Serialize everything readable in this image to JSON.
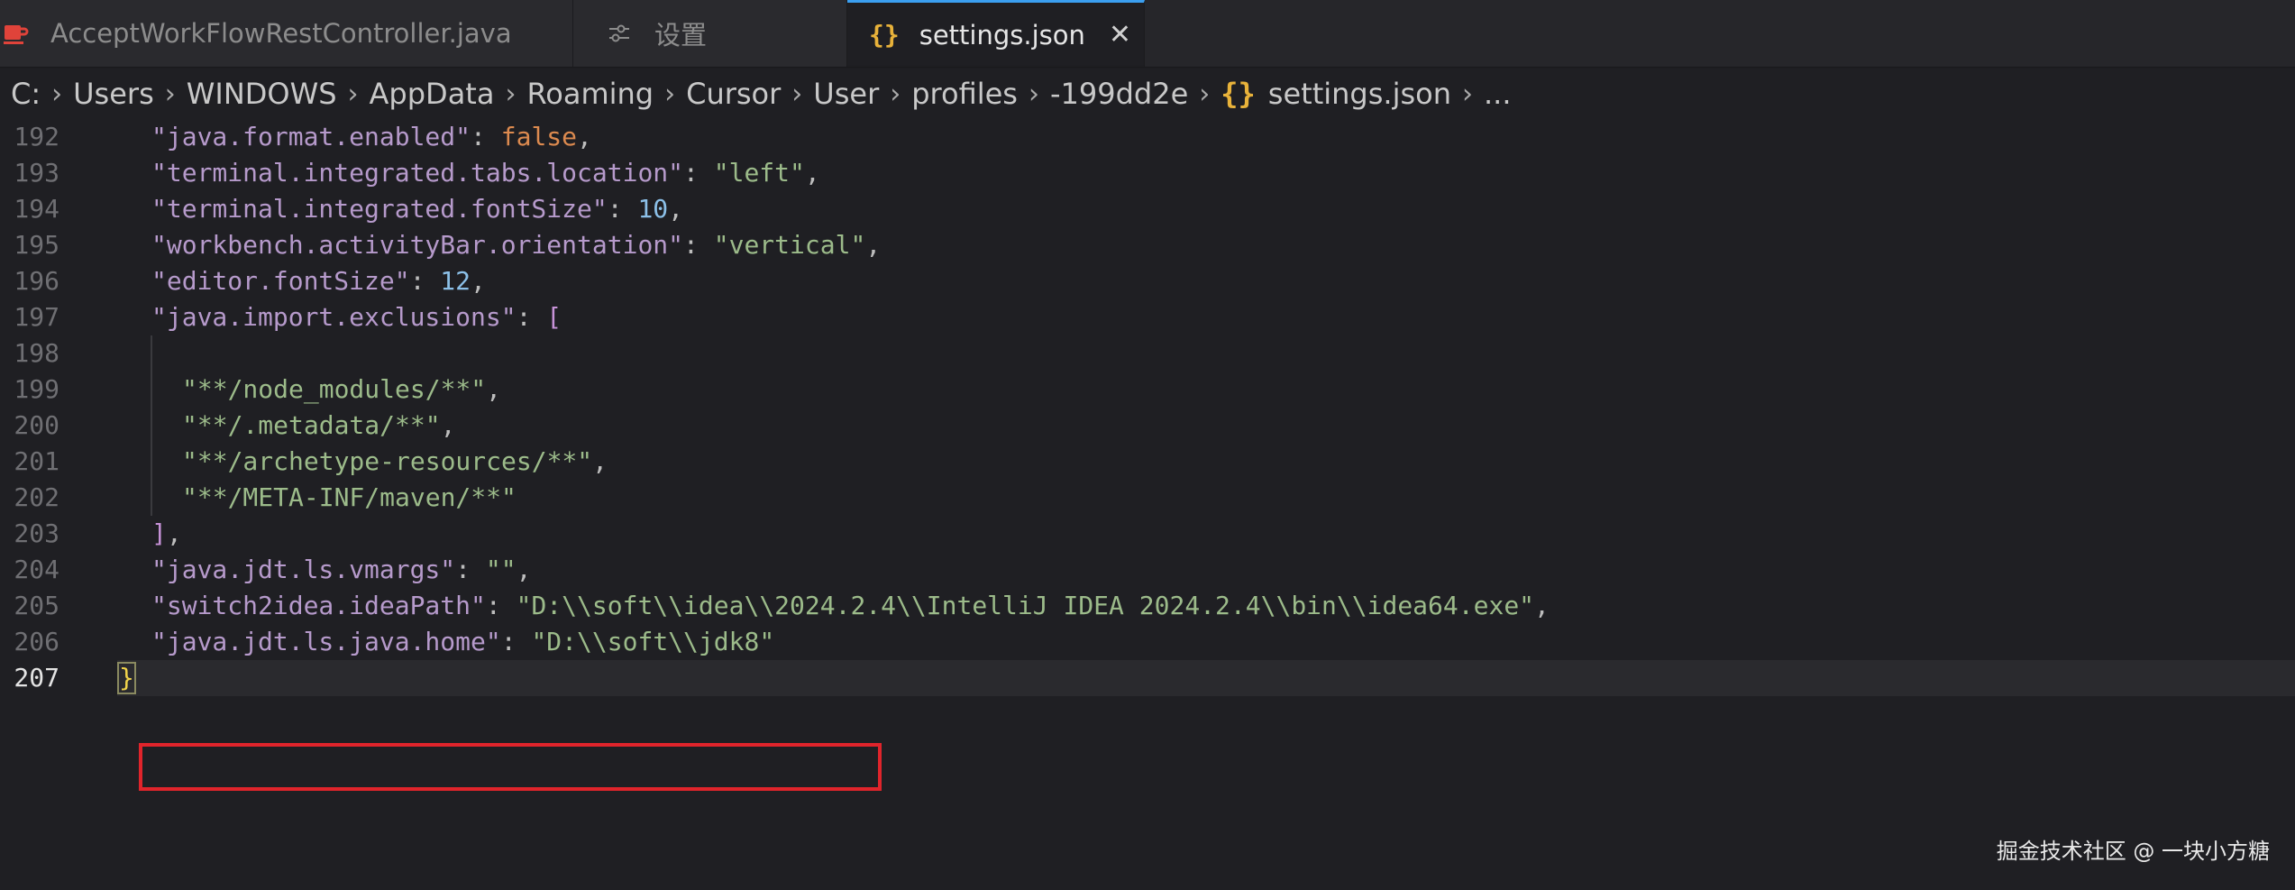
{
  "tabs": [
    {
      "label": "AcceptWorkFlowRestController.java",
      "icon": "java-icon",
      "active": false
    },
    {
      "label": "设置",
      "icon": "settings-icon",
      "active": false
    },
    {
      "label": "settings.json",
      "icon": "json-braces-icon",
      "active": true
    }
  ],
  "breadcrumb": [
    "C:",
    "Users",
    "WINDOWS",
    "AppData",
    "Roaming",
    "Cursor",
    "User",
    "profiles",
    "-199dd2e",
    "settings.json",
    "..."
  ],
  "editor": {
    "line_numbers": [
      "192",
      "193",
      "194",
      "195",
      "196",
      "197",
      "198",
      "199",
      "200",
      "201",
      "202",
      "203",
      "204",
      "205",
      "206",
      "207"
    ],
    "current_line": "207",
    "lines": {
      "l192": {
        "key": "\"java.format.enabled\"",
        "sep": ": ",
        "value": "false",
        "end": ","
      },
      "l193": {
        "key": "\"terminal.integrated.tabs.location\"",
        "sep": ": ",
        "value": "\"left\"",
        "end": ","
      },
      "l194": {
        "key": "\"terminal.integrated.fontSize\"",
        "sep": ": ",
        "value": "10",
        "end": ","
      },
      "l195": {
        "key": "\"workbench.activityBar.orientation\"",
        "sep": ": ",
        "value": "\"vertical\"",
        "end": ","
      },
      "l196": {
        "key": "\"editor.fontSize\"",
        "sep": ": ",
        "value": "12",
        "end": ","
      },
      "l197": {
        "key": "\"java.import.exclusions\"",
        "sep": ": ",
        "value": "["
      },
      "l199": {
        "value": "\"**/node_modules/**\"",
        "end": ","
      },
      "l200": {
        "value": "\"**/.metadata/**\"",
        "end": ","
      },
      "l201": {
        "value": "\"**/archetype-resources/**\"",
        "end": ","
      },
      "l202": {
        "value": "\"**/META-INF/maven/**\""
      },
      "l203": {
        "value": "]",
        "end": ","
      },
      "l204": {
        "key": "\"java.jdt.ls.vmargs\"",
        "sep": ": ",
        "value": "\"\"",
        "end": ","
      },
      "l205": {
        "key": "\"switch2idea.ideaPath\"",
        "sep": ": ",
        "value": "\"D:\\\\soft\\\\idea\\\\2024.2.4\\\\IntelliJ IDEA 2024.2.4\\\\bin\\\\idea64.exe\"",
        "end": ","
      },
      "l206": {
        "key": "\"java.jdt.ls.java.home\"",
        "sep": ": ",
        "value": "\"D:\\\\soft\\\\jdk8\""
      },
      "l207": {
        "value": "}"
      }
    }
  },
  "watermark": "掘金技术社区 @ 一块小方糖",
  "colors": {
    "background": "#1f1f23",
    "tab_active_border": "#3b9ff0",
    "json_icon": "#e8b23a",
    "key": "#b69acb",
    "string": "#9cbb8a",
    "boolean": "#dc8a4f",
    "number": "#8cc0e8",
    "highlight_box": "#e0242b"
  }
}
